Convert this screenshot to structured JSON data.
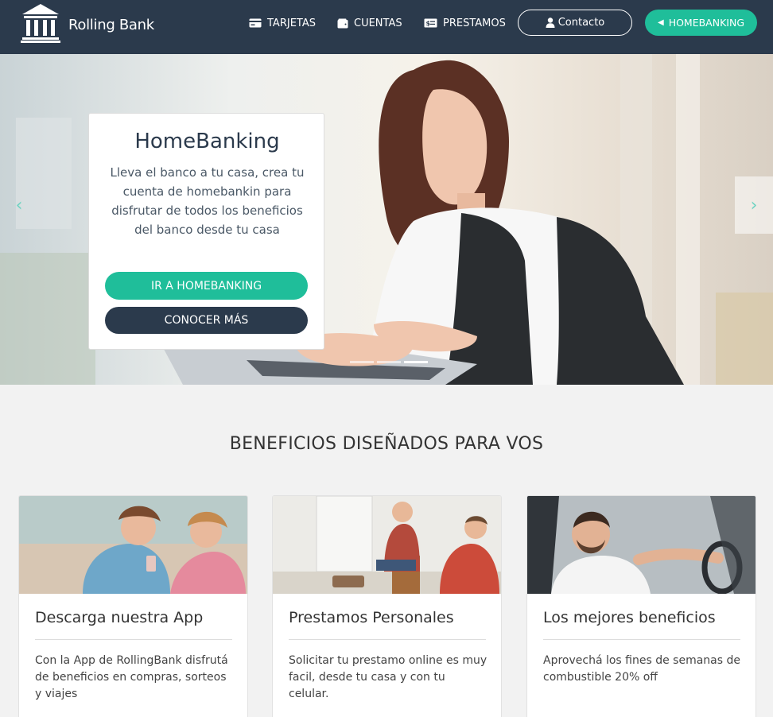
{
  "brand": {
    "name": "Rolling Bank",
    "icon": "bank-columns-icon"
  },
  "nav": {
    "items": [
      {
        "label": "TARJETAS",
        "icon": "credit-card-icon"
      },
      {
        "label": "CUENTAS",
        "icon": "wallet-icon"
      },
      {
        "label": "PRESTAMOS",
        "icon": "money-bill-icon"
      }
    ],
    "contact_label": "Contacto",
    "contact_icon": "user-icon",
    "homebanking_label": "HOMEBANKING",
    "homebanking_icon": "chevron-left-icon"
  },
  "hero": {
    "title": "HomeBanking",
    "text": "Lleva el banco a tu casa, crea tu cuenta de homebankin para disfrutar de todos los beneficios del banco desde tu casa",
    "primary_button": "IR A HOMEBANKING",
    "secondary_button": "CONOCER MÁS",
    "prev_arrow": "‹",
    "next_arrow": "›",
    "slides": 3,
    "active_slide": 3
  },
  "benefits": {
    "title": "BENEFICIOS DISEÑADOS PARA VOS",
    "cards": [
      {
        "title": "Descarga nuestra App",
        "text": "Con la App de RollingBank disfrutá de beneficios en compras, sorteos y viajes"
      },
      {
        "title": "Prestamos Personales",
        "text": "Solicitar tu prestamo online es muy facil, desde tu casa y con tu celular."
      },
      {
        "title": "Los mejores beneficios",
        "text": "Aprovechá los fines de semanas de combustible 20% off"
      }
    ]
  },
  "colors": {
    "navbar": "#2b3a4c",
    "accent": "#1fbe9a",
    "dark_button": "#2b3a4c",
    "arrow": "#6fd3c2"
  }
}
